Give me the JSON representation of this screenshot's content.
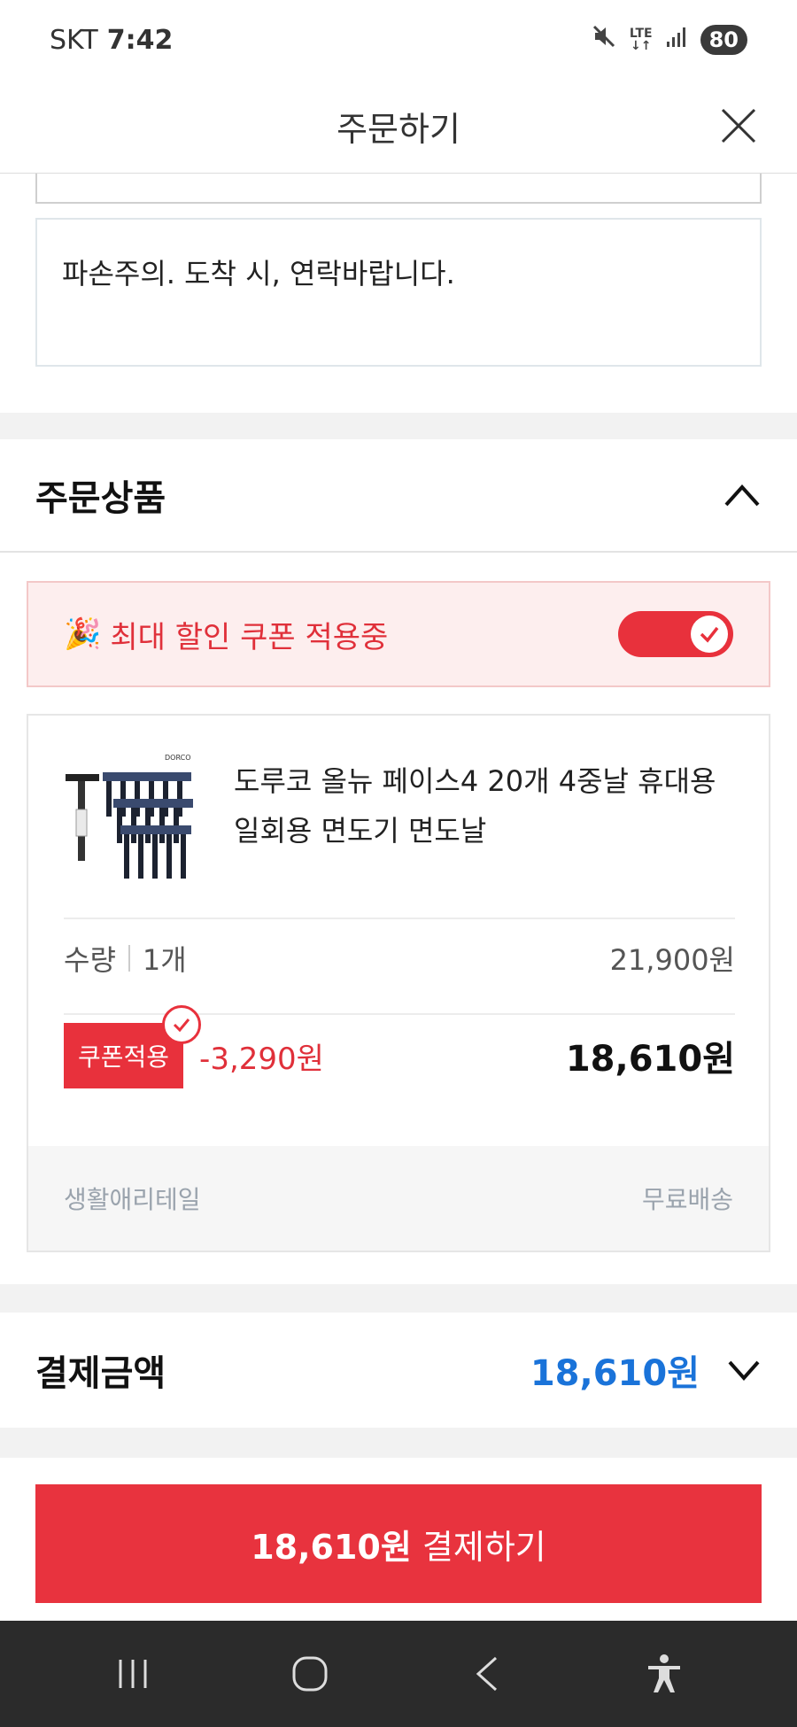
{
  "status_bar": {
    "carrier": "SKT",
    "time": "7:42",
    "network_top": "LTE",
    "network_bottom": "↓↑",
    "battery": "80"
  },
  "header": {
    "title": "주문하기"
  },
  "memo": {
    "text": "파손주의. 도착 시, 연락바랍니다."
  },
  "order_section": {
    "title": "주문상품",
    "coupon_banner": {
      "icon": "🎉",
      "text": "최대 할인 쿠폰 적용중",
      "toggle_on": true
    },
    "product": {
      "image_brand": "DORCO",
      "name_line1": "도루코 올뉴 페이스4 20개 4중날 휴대용",
      "name_line2": "일회용 면도기 면도날",
      "quantity_label": "수량",
      "quantity_value": "1개",
      "original_price": "21,900원",
      "coupon_tag": "쿠폰적용",
      "discount": "-3,290원",
      "final_price": "18,610원",
      "seller": "생활애리테일",
      "shipping": "무료배송"
    }
  },
  "payment": {
    "label": "결제금액",
    "amount": "18,610원"
  },
  "pay_button": {
    "amount": "18,610원",
    "text": " 결제하기"
  },
  "colors": {
    "accent_red": "#e8313c",
    "accent_blue": "#1a73d9"
  }
}
